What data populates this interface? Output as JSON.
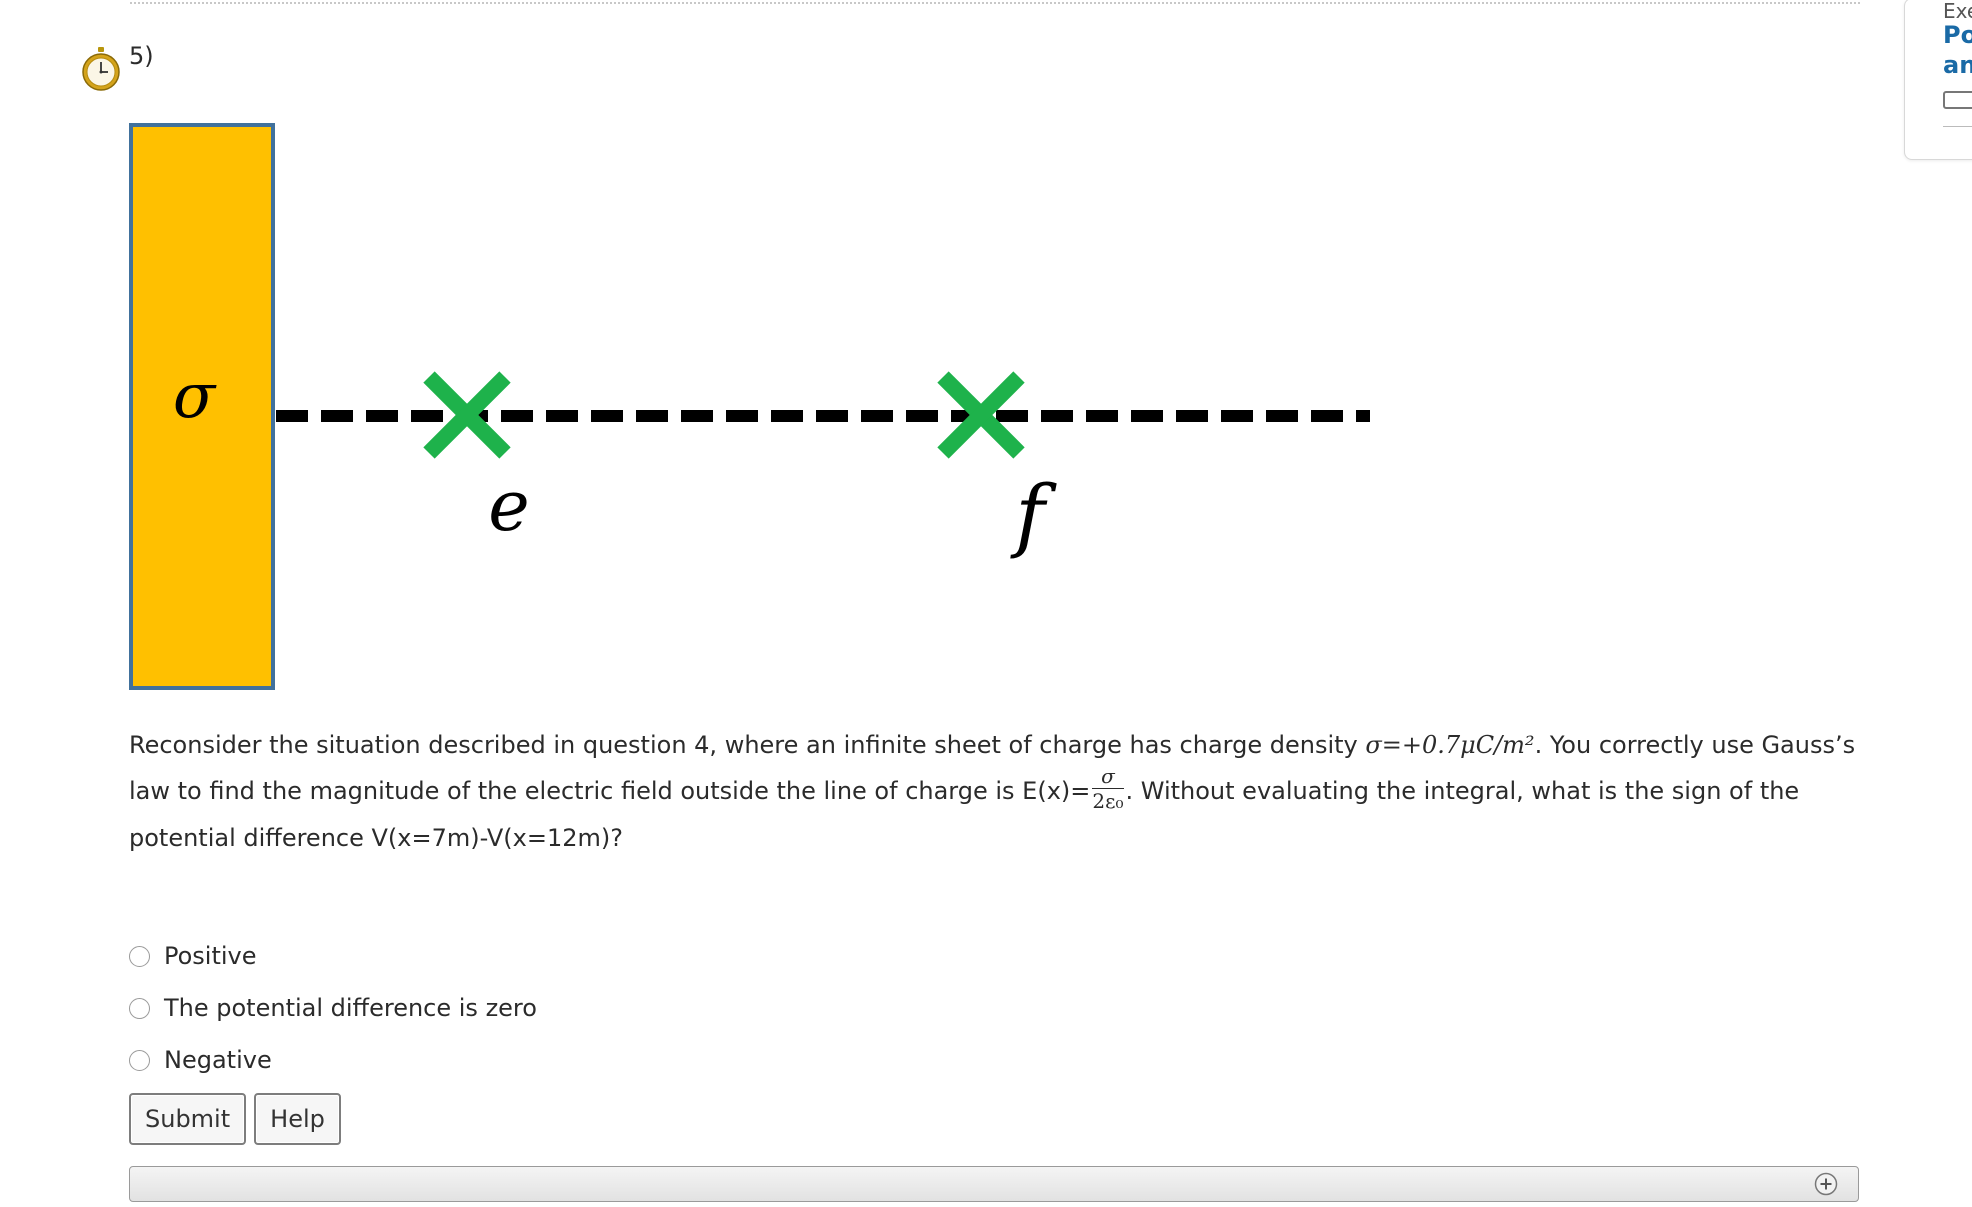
{
  "question": {
    "number": "5)",
    "text_part1": "Reconsider the situation described in question 4, where an infinite sheet of charge has charge density ",
    "density_math": "σ=+0.7μC/m²",
    "text_part2": ". You correctly use Gauss’s law to find the magnitude of the electric field outside the line of charge is E(x)=",
    "frac_num": "σ",
    "frac_den": "2ε₀",
    "text_part3": ". Without evaluating the integral, what is the sign of the potential difference V(x=7m)-V(x=12m)?"
  },
  "diagram": {
    "sheet_label": "σ",
    "point_e_label": "e",
    "point_f_label": "f",
    "colors": {
      "sheet_fill": "#FFC000",
      "sheet_border": "#41719C",
      "marker": "#1EB24B",
      "line": "#000000"
    }
  },
  "options": [
    {
      "label": "Positive"
    },
    {
      "label": "The potential difference is zero"
    },
    {
      "label": "Negative"
    }
  ],
  "buttons": {
    "submit": "Submit",
    "help": "Help"
  },
  "side_panel": {
    "line1": "Exe",
    "line2": "Pot",
    "line3": "and"
  },
  "icons": {
    "timer": "stopwatch-icon",
    "expand": "plus-circle-icon"
  }
}
